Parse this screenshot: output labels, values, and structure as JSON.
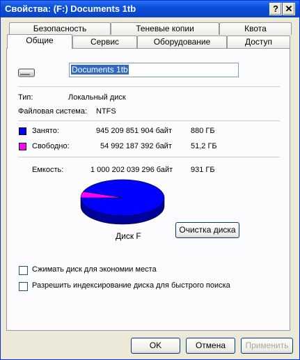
{
  "window": {
    "title": "Свойства: (F:) Documents 1tb",
    "help_label": "?",
    "close_label": "✕"
  },
  "tabs_back": [
    "Безопасность",
    "Теневые копии",
    "Квота"
  ],
  "tabs_front": [
    "Общие",
    "Сервис",
    "Оборудование",
    "Доступ"
  ],
  "drive": {
    "icon": "drive-icon",
    "name": "Documents 1tb",
    "type_label": "Тип:",
    "type_value": "Локальный диск",
    "fs_label": "Файловая система:",
    "fs_value": "NTFS"
  },
  "usage": {
    "used_label": "Занято:",
    "used_bytes": "945 209 851 904 байт",
    "used_size": "880 ГБ",
    "used_color": "#0000ff",
    "free_label": "Свободно:",
    "free_bytes": "54 992 187 392 байт",
    "free_size": "51,2 ГБ",
    "free_color": "#ff00ff",
    "capacity_label": "Емкость:",
    "capacity_bytes": "1 000 202 039 296 байт",
    "capacity_size": "931 ГБ"
  },
  "chart_data": {
    "type": "pie",
    "categories": [
      "Занято",
      "Свободно"
    ],
    "values": [
      945209851904,
      54992187392
    ]
  },
  "disk_label": "Диск F",
  "cleanup_button": "Очистка диска",
  "options": {
    "compress_label": "Сжимать диск для экономии места",
    "index_label": "Разрешить индексирование диска для быстрого поиска"
  },
  "footer": {
    "ok": "OK",
    "cancel": "Отмена",
    "apply": "Применить"
  }
}
